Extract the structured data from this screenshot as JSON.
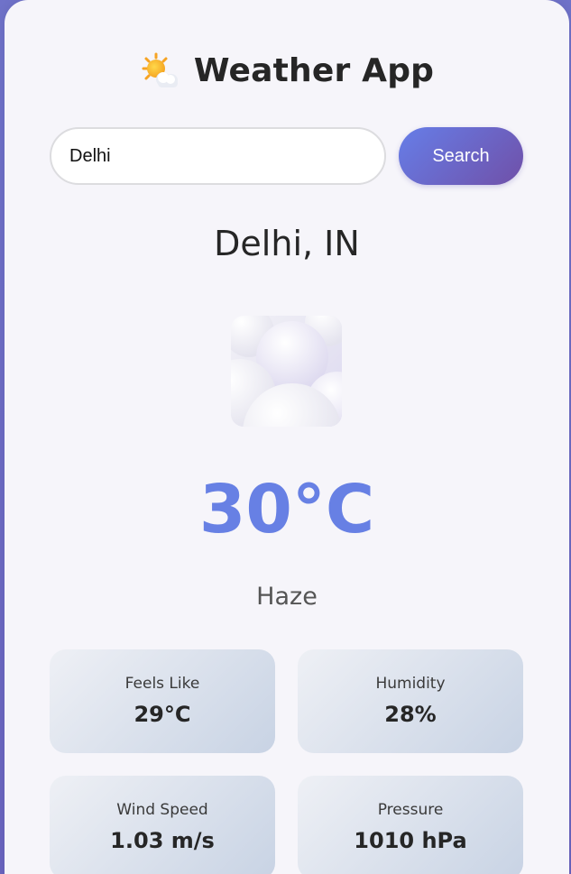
{
  "app": {
    "title": "Weather App",
    "title_icon": "sun-behind-cloud-icon"
  },
  "search": {
    "value": "Delhi",
    "button_label": "Search"
  },
  "location": "Delhi, IN",
  "weather": {
    "icon": "cloud-icon",
    "temperature": "30°C",
    "description": "Haze"
  },
  "stats": [
    {
      "label": "Feels Like",
      "value": "29°C"
    },
    {
      "label": "Humidity",
      "value": "28%"
    },
    {
      "label": "Wind Speed",
      "value": "1.03 m/s"
    },
    {
      "label": "Pressure",
      "value": "1010 hPa"
    }
  ],
  "colors": {
    "accent": "#6780e4",
    "button_gradient_start": "#667ee8",
    "button_gradient_end": "#7050a8",
    "background": "#6f72c9",
    "card": "#f6f5fa"
  }
}
